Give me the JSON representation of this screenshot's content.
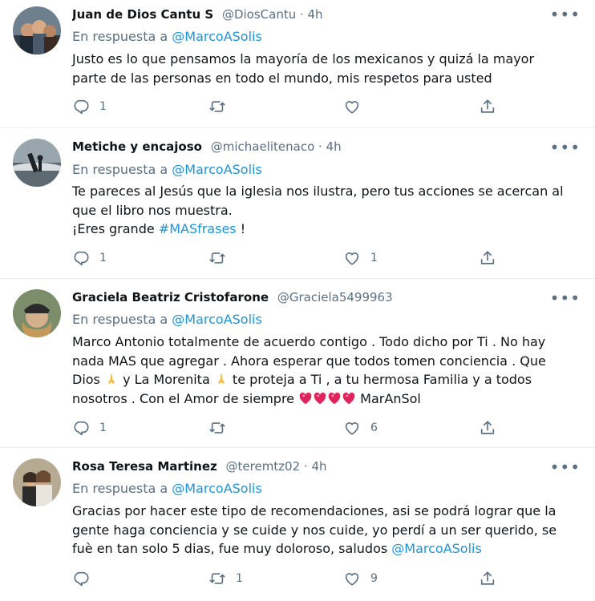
{
  "tweets": [
    {
      "name": "Juan de Dios Cantu S",
      "handle": "@DiosCantu · 4h",
      "reply_prefix": "En respuesta a",
      "reply_to": "@MarcoASolis",
      "line1": "Justo es lo que pensamos la mayoría de los mexicanos y quizá la mayor",
      "line2": "parte de las personas en todo el mundo, mis respetos para usted",
      "replies": "1",
      "retweets": "",
      "likes": ""
    },
    {
      "name": "Metiche y encajoso",
      "handle": "@michaelitenaco · 4h",
      "reply_prefix": "En respuesta a",
      "reply_to": "@MarcoASolis",
      "line1": "Te pareces al Jesús que la iglesia nos ilustra, pero tus acciones se acercan al",
      "line2": "que el libro nos muestra.",
      "line3_pre": "¡Eres grande ",
      "line3_tag": "#MASfrases",
      "line3_post": " !",
      "replies": "1",
      "retweets": "",
      "likes": "1"
    },
    {
      "name": "Graciela Beatriz Cristofarone",
      "handle": "@Graciela5499963",
      "reply_prefix": "En respuesta a",
      "reply_to": "@MarcoASolis",
      "line1": "Marco Antonio totalmente de acuerdo contigo . Todo dicho por Ti . No hay",
      "line2": "nada MAS que agregar . Ahora esperar que todos tomen conciencia . Que",
      "line3_a": "Dios ",
      "line3_b": " y La Morenita ",
      "line3_c": " te proteja a Ti , a tu hermosa Familia y a todos",
      "line4_a": "nosotros . Con el Amor de siempre ",
      "line4_b": " MarAnSol",
      "replies": "1",
      "retweets": "",
      "likes": "6"
    },
    {
      "name": "Rosa Teresa Martinez",
      "handle": "@teremtz02 · 4h",
      "reply_prefix": "En respuesta a",
      "reply_to": "@MarcoASolis",
      "line1": "Gracias por hacer este tipo de recomendaciones, asi se podrá lograr que la",
      "line2": "gente haga conciencia y se cuide y nos cuide, yo perdí a un ser querido, se",
      "line3_pre": "fuè en tan solo 5 dias, fue muy doloroso, saludos ",
      "line3_tag": "@MarcoASolis",
      "replies": "",
      "retweets": "1",
      "likes": "9"
    }
  ],
  "colors": {
    "accent": "#1b95e0",
    "muted": "#5b7083",
    "divider": "#ebeef0"
  },
  "icons": [
    "reply-icon",
    "retweet-icon",
    "like-icon",
    "share-icon",
    "more-icon"
  ]
}
